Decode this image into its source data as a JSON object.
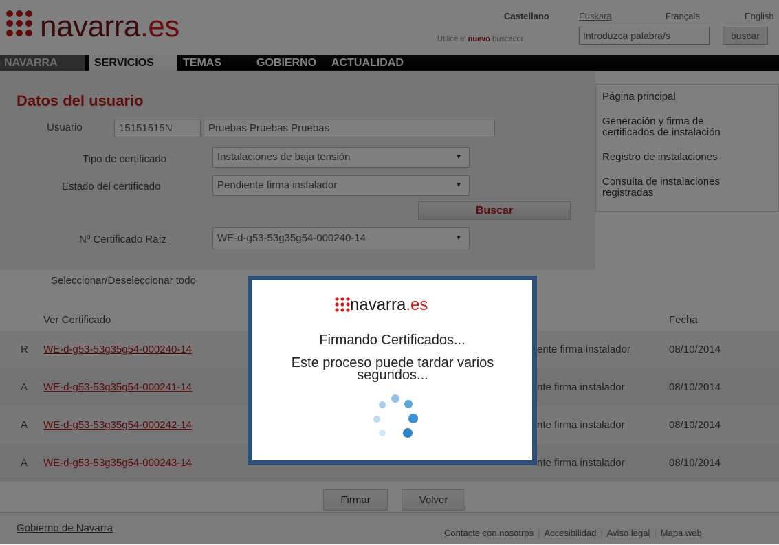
{
  "header": {
    "logo_text": "navarra",
    "logo_tld": ".es",
    "languages": [
      "Castellano",
      "Euskara",
      "Français",
      "English"
    ],
    "search_hint_pre": "Utilice el ",
    "search_hint_bold": "nuevo",
    "search_hint_post": " buscador",
    "search_placeholder": "Introduzca palabra/s",
    "search_button": "buscar"
  },
  "nav": {
    "items": [
      "NAVARRA",
      "SERVICIOS",
      "TEMAS",
      "GOBIERNO",
      "ACTUALIDAD"
    ],
    "active": "SERVICIOS"
  },
  "form": {
    "title": "Datos del usuario",
    "usuario_label": "Usuario",
    "usuario_id": "15151515N",
    "usuario_name": "Pruebas Pruebas Pruebas",
    "tipo_label": "Tipo de certificado",
    "tipo_value": "Instalaciones de baja tensión",
    "estado_label": "Estado del certificado",
    "estado_value": "Pendiente firma instalador",
    "buscar_button": "Buscar",
    "raiz_label": "Nº Certificado Raíz",
    "raiz_value": "WE-d-g53-53g35g54-000240-14"
  },
  "sidebar": {
    "links": [
      "Página principal",
      "Generación y firma de certificados de instalación",
      "Registro de instalaciones",
      "Consulta de instalaciones registradas"
    ]
  },
  "table": {
    "select_all_label": "Seleccionar/Deseleccionar todo",
    "col_ver": "Ver Certificado",
    "col_fecha": "Fecha",
    "rows": [
      {
        "tipo": "R",
        "cert": "WE-d-g53-53g35g54-000240-14",
        "estado": "ente firma instalador",
        "fecha": "08/10/2014"
      },
      {
        "tipo": "A",
        "cert": "WE-d-g53-53g35g54-000241-14",
        "estado": "nte firma instalador",
        "fecha": "08/10/2014"
      },
      {
        "tipo": "A",
        "cert": "WE-d-g53-53g35g54-000242-14",
        "estado": "nte firma instalador",
        "fecha": "08/10/2014"
      },
      {
        "tipo": "A",
        "cert": "WE-d-g53-53g35g54-000243-14",
        "estado": "nte firma instalador",
        "fecha": "08/10/2014"
      }
    ]
  },
  "actions": {
    "firmar": "Firmar",
    "volver": "Volver"
  },
  "footer": {
    "gobierno": "Gobierno de Navarra",
    "links": [
      "Contacte con nosotros",
      "Accesibilidad",
      "Aviso legal",
      "Mapa web"
    ]
  },
  "modal": {
    "logo_text": "navarra",
    "logo_tld": ".es",
    "title": "Firmando Certificados...",
    "message": "Este proceso puede tardar varios segundos..."
  },
  "colors": {
    "brand_red": "#d21a1a",
    "modal_border": "#2d4e77",
    "spinner_blue": "#2f86c7"
  }
}
